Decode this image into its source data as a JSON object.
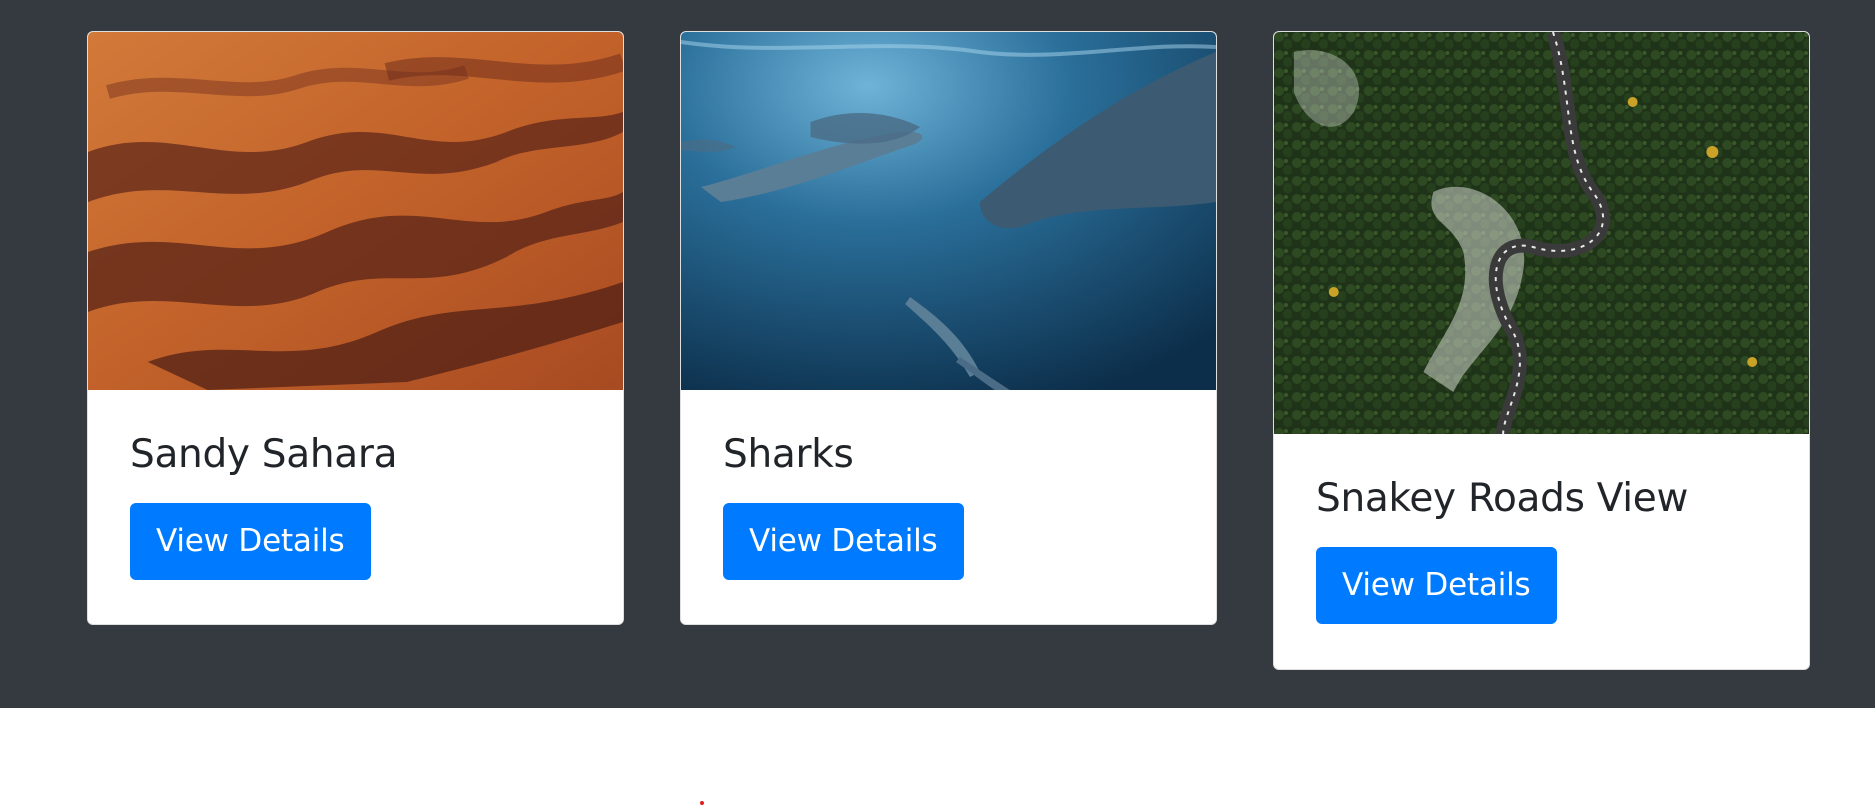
{
  "cards": [
    {
      "title": "Sandy Sahara",
      "button_label": "View Details",
      "image": "desert-dunes-image"
    },
    {
      "title": "Sharks",
      "button_label": "View Details",
      "image": "underwater-dolphins-image"
    },
    {
      "title": "Snakey Roads View",
      "button_label": "View Details",
      "image": "forest-road-aerial-image"
    }
  ],
  "colors": {
    "background": "#343a40",
    "button": "#007bff",
    "title": "#212529"
  }
}
